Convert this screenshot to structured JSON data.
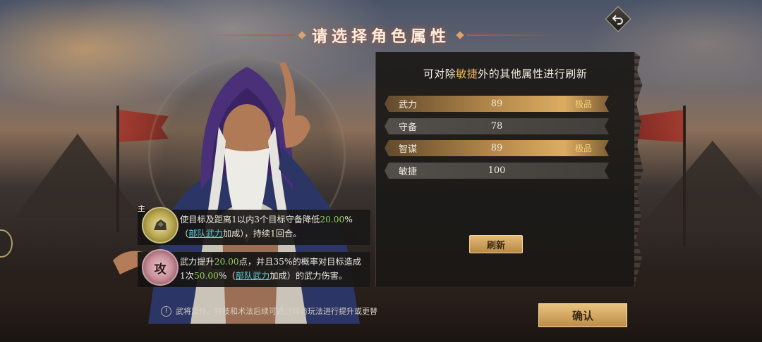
{
  "header": {
    "title": "请选择角色属性",
    "back_icon": "return-arrow-icon"
  },
  "panel": {
    "subtitle_prefix": "可对除",
    "subtitle_highlight": "敏捷",
    "subtitle_suffix": "外的其他属性进行刷新",
    "stats": [
      {
        "label": "武力",
        "value": "89",
        "grade": "极品",
        "highlighted": true
      },
      {
        "label": "守备",
        "value": "78",
        "grade": "",
        "highlighted": false
      },
      {
        "label": "智谋",
        "value": "89",
        "grade": "极品",
        "highlighted": true
      },
      {
        "label": "敏捷",
        "value": "100",
        "grade": "",
        "highlighted": false
      }
    ],
    "refresh_label": "刷新"
  },
  "skills": [
    {
      "tag": "主",
      "icon": "main-skill-icon",
      "text_1": "使目标及距离1以内3个目标守备降低",
      "num_1": "20.00",
      "text_2": "%（",
      "link_1": "部队武力",
      "text_3": "加成），持续1回合。"
    },
    {
      "tag": "攻",
      "icon": "attack-skill-icon",
      "text_1": "武力提升",
      "num_1": "20.00",
      "text_2": "点，并且35%的概率对目标造成1次",
      "num_2": "50.00",
      "text_3": "%（",
      "link_1": "部队武力",
      "text_4": "加成）的武力伤害。"
    }
  ],
  "footer": {
    "hint_icon": "!",
    "hint": "武将属性、特技和术法后续可通过拜访玩法进行提升或更替",
    "confirm_label": "确认"
  },
  "colors": {
    "gold_accent": "#f0b65a",
    "green_number": "#9ed35c",
    "link_cyan": "#5fd0d8",
    "button_gold": "#d9ab64"
  }
}
